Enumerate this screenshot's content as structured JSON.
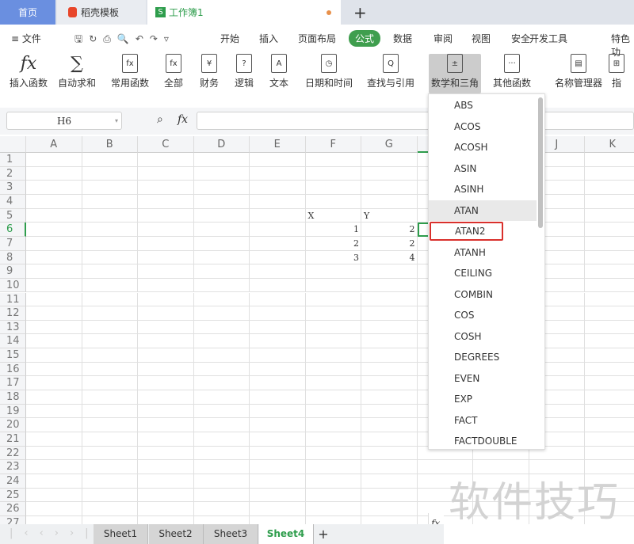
{
  "tabs": {
    "home": "首页",
    "daoke": "稻壳模板",
    "book": "工作簿1",
    "book_icon": "S"
  },
  "menu": {
    "file": "≡ 文件",
    "items": [
      "开始",
      "插入",
      "页面布局",
      "公式",
      "数据",
      "审阅",
      "视图",
      "安全",
      "开发工具",
      "特色功"
    ],
    "active": "公式"
  },
  "ribbon": [
    {
      "label": "插入函数",
      "icon": "fx"
    },
    {
      "label": "自动求和",
      "icon": "∑"
    },
    {
      "label": "常用函数",
      "icon": "fx"
    },
    {
      "label": "全部",
      "icon": "fx"
    },
    {
      "label": "财务",
      "icon": "¥"
    },
    {
      "label": "逻辑",
      "icon": "?"
    },
    {
      "label": "文本",
      "icon": "A"
    },
    {
      "label": "日期和时间",
      "icon": "◷"
    },
    {
      "label": "查找与引用",
      "icon": "Q"
    },
    {
      "label": "数学和三角",
      "icon": "±"
    },
    {
      "label": "其他函数",
      "icon": "···"
    },
    {
      "label": "名称管理器",
      "icon": "▤"
    },
    {
      "label": "指",
      "icon": "⊞"
    }
  ],
  "formula_bar": {
    "name_box": "H6",
    "fx": "fx",
    "value": ""
  },
  "columns": [
    "A",
    "B",
    "C",
    "D",
    "E",
    "F",
    "G",
    "H",
    "I",
    "J",
    "K"
  ],
  "cells": [
    {
      "ref": "F5",
      "value": "X",
      "align": "left"
    },
    {
      "ref": "G5",
      "value": "Y",
      "align": "left"
    },
    {
      "ref": "F6",
      "value": "1"
    },
    {
      "ref": "G6",
      "value": "2"
    },
    {
      "ref": "F7",
      "value": "2"
    },
    {
      "ref": "G7",
      "value": "2"
    },
    {
      "ref": "F8",
      "value": "3"
    },
    {
      "ref": "G8",
      "value": "4"
    }
  ],
  "selected_cell": "H6",
  "dropdown": {
    "items": [
      "ABS",
      "ACOS",
      "ACOSH",
      "ASIN",
      "ASINH",
      "ATAN",
      "ATAN2",
      "ATANH",
      "CEILING",
      "COMBIN",
      "COS",
      "COSH",
      "DEGREES",
      "EVEN",
      "EXP",
      "FACT",
      "FACTDOUBLE"
    ],
    "hover": "ATAN",
    "highlighted": "ATAN2",
    "footer": "fx"
  },
  "sheets": [
    "Sheet1",
    "Sheet2",
    "Sheet3",
    "Sheet4"
  ],
  "active_sheet": "Sheet4",
  "add_sheet": "+",
  "watermark": "软件技巧",
  "colors": {
    "accent": "#3f9e4e",
    "highlight": "#d9302c",
    "home_tab": "#6a8fe0"
  }
}
